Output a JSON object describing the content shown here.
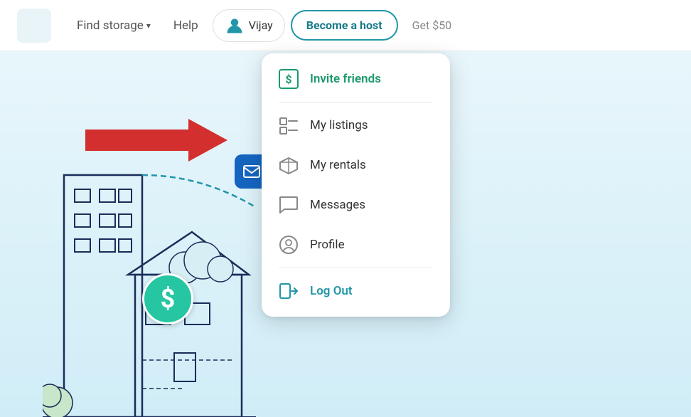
{
  "header": {
    "find_storage_label": "Find storage",
    "help_label": "Help",
    "user_label": "Vijay",
    "become_host_label": "Become a host",
    "get_50_label": "Get $50"
  },
  "dropdown": {
    "items": [
      {
        "id": "invite-friends",
        "label": "Invite friends",
        "icon": "invite-icon",
        "type": "invite",
        "divider_after": true
      },
      {
        "id": "my-listings",
        "label": "My listings",
        "icon": "listings-icon",
        "type": "normal",
        "divider_after": false
      },
      {
        "id": "my-rentals",
        "label": "My rentals",
        "icon": "rentals-icon",
        "type": "normal",
        "divider_after": false
      },
      {
        "id": "messages",
        "label": "Messages",
        "icon": "messages-icon",
        "type": "normal",
        "divider_after": false
      },
      {
        "id": "profile",
        "label": "Profile",
        "icon": "profile-icon",
        "type": "normal",
        "divider_after": true
      },
      {
        "id": "logout",
        "label": "Log Out",
        "icon": "logout-icon",
        "type": "logout",
        "divider_after": false
      }
    ]
  },
  "colors": {
    "invite_green": "#1a9a6a",
    "logout_blue": "#2196a8",
    "text_normal": "#333333",
    "divider": "#e8e8e8",
    "icon_gray": "#888888"
  }
}
